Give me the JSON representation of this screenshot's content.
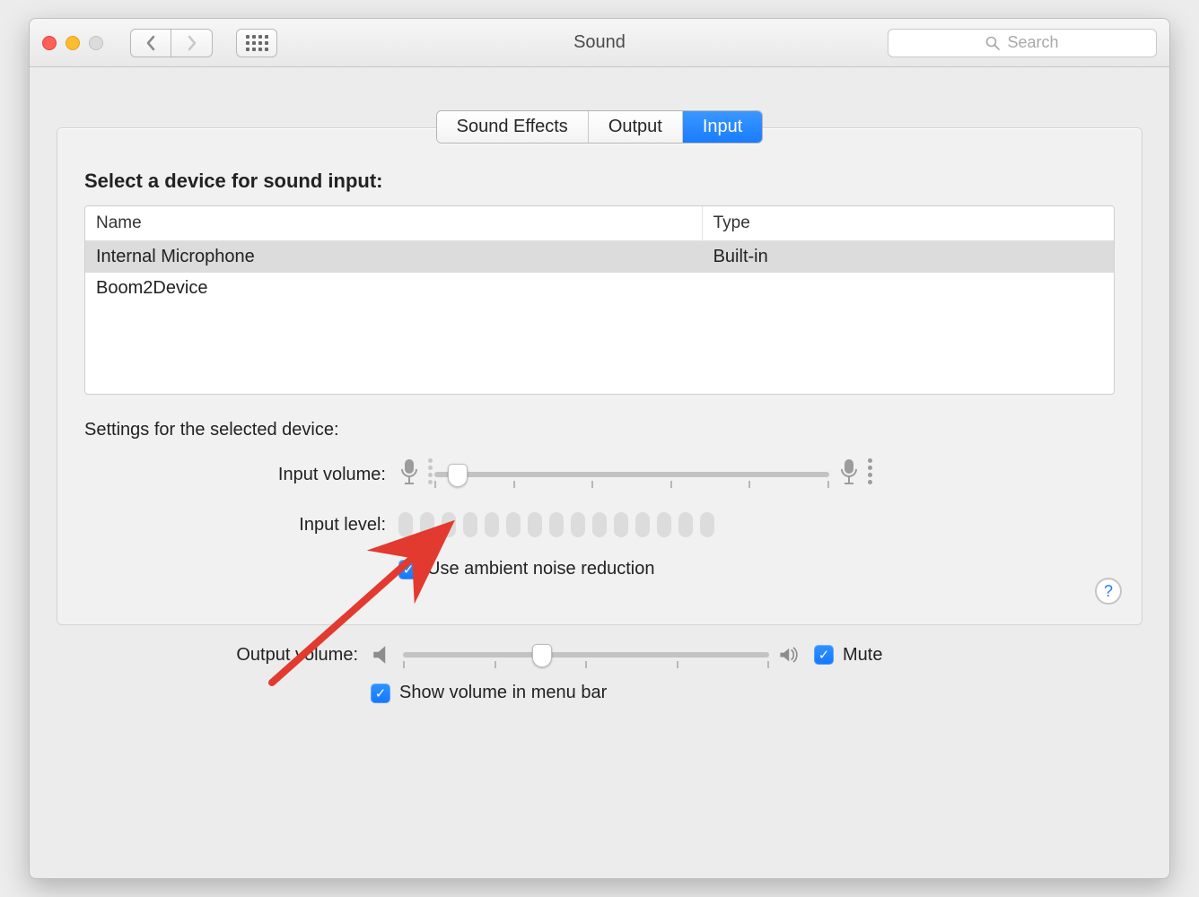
{
  "window": {
    "title": "Sound"
  },
  "search": {
    "placeholder": "Search"
  },
  "tabs": {
    "effects": "Sound Effects",
    "output": "Output",
    "input": "Input",
    "active": "input"
  },
  "panel": {
    "heading": "Select a device for sound input:",
    "columns": {
      "name": "Name",
      "type": "Type"
    },
    "devices": [
      {
        "name": "Internal Microphone",
        "type": "Built-in",
        "selected": true
      },
      {
        "name": "Boom2Device",
        "type": "",
        "selected": false
      }
    ],
    "settings_heading": "Settings for the selected device:",
    "input_volume_label": "Input volume:",
    "input_volume_percent": 6,
    "input_level_label": "Input level:",
    "input_level_segments": 15,
    "noise_reduction_label": "Use ambient noise reduction",
    "noise_reduction_checked": true
  },
  "footer": {
    "output_volume_label": "Output volume:",
    "output_volume_percent": 38,
    "mute_label": "Mute",
    "mute_checked": true,
    "show_volume_label": "Show volume in menu bar",
    "show_volume_checked": true
  },
  "colors": {
    "accent": "#1a7cff",
    "annotation": "#e23a2e"
  }
}
